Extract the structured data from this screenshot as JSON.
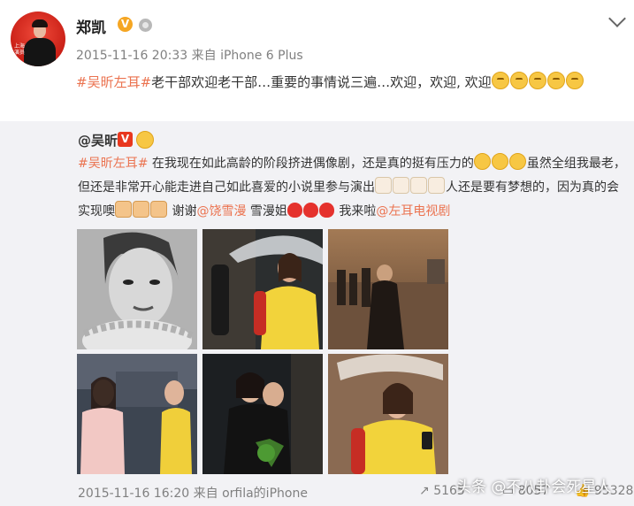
{
  "author": {
    "name": "郑凯",
    "verified_badge": "V",
    "timestamp": "2015-11-16 20:33",
    "source_prefix": "来自",
    "source": "iPhone 6 Plus",
    "avatar_caption": "上海 演员"
  },
  "post": {
    "hashtag": "#吴昕左耳#",
    "text": "老干部欢迎老干部…重要的事情说三遍…欢迎，欢迎, 欢迎"
  },
  "repost": {
    "author": "@吴昕",
    "verified_badge": "V",
    "hashtag": "#吴昕左耳#",
    "text1": " 在我现在如此高龄的阶段挤进偶像剧，还是真的挺有压力的",
    "text2": "虽然全组我最老，但还是非常开心能走进自己如此喜爱的小说里参与演出",
    "text3": "人还是要有梦想的，因为真的会实现噢",
    "text4": " 谢谢",
    "mention1": "@饶雪漫",
    "text5": " 雪漫姐",
    "text6": " 我来啦",
    "mention2": "@左耳电视剧",
    "timestamp": "2015-11-16 16:20",
    "source_prefix": "来自",
    "source": "orfila的iPhone",
    "repost_count": "5165",
    "comment_count": "8057",
    "like_count": "95328"
  },
  "watermark": "头条 @不八卦会死星人",
  "icons": [
    "chevron-down-icon",
    "verified-icon",
    "repost-icon",
    "comment-icon",
    "like-icon"
  ]
}
